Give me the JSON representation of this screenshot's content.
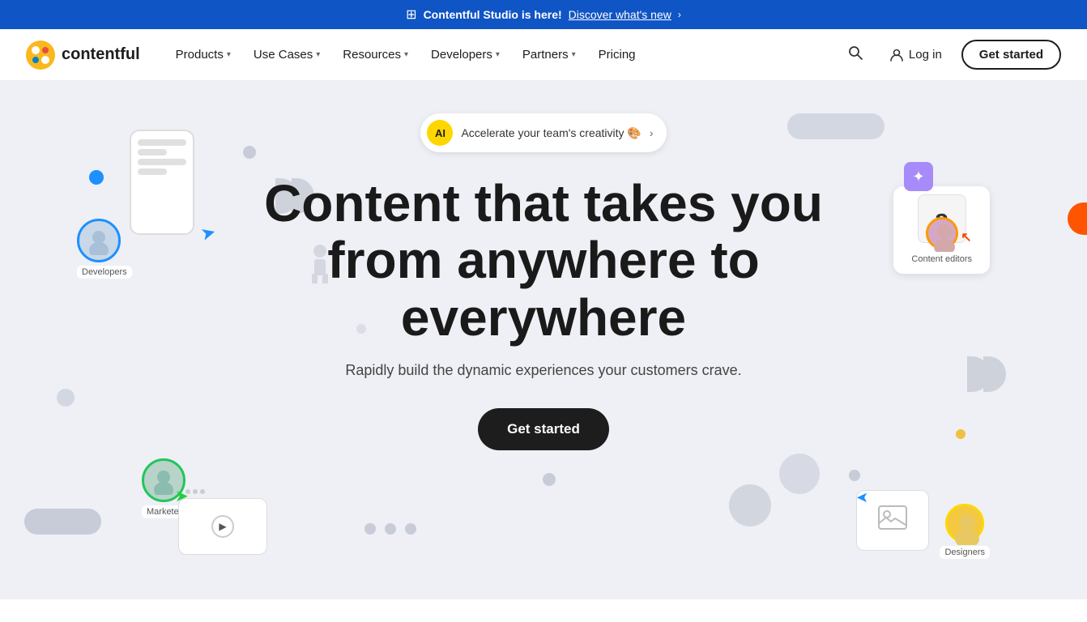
{
  "banner": {
    "icon": "⊞",
    "brand": "Contentful Studio is here!",
    "link_text": "Discover what's new",
    "arrow": "›"
  },
  "navbar": {
    "logo_text": "contentful",
    "nav_items": [
      {
        "label": "Products",
        "has_dropdown": true
      },
      {
        "label": "Use Cases",
        "has_dropdown": true
      },
      {
        "label": "Resources",
        "has_dropdown": true
      },
      {
        "label": "Developers",
        "has_dropdown": true
      },
      {
        "label": "Partners",
        "has_dropdown": true
      },
      {
        "label": "Pricing",
        "has_dropdown": false
      }
    ],
    "login_label": "Log in",
    "get_started_label": "Get started"
  },
  "hero": {
    "ai_badge": "AI",
    "ai_text": "Accelerate your team's creativity 🎨",
    "ai_arrow": "›",
    "headline_line1": "Content that takes you",
    "headline_line2": "from anywhere to",
    "headline_line3": "everywhere",
    "subtext": "Rapidly build the dynamic experiences your customers crave.",
    "cta_label": "Get started"
  },
  "floating": {
    "developers_label": "Developers",
    "content_editors_label": "Content editors",
    "marketers_label": "Marketers",
    "designers_label": "Designers"
  }
}
